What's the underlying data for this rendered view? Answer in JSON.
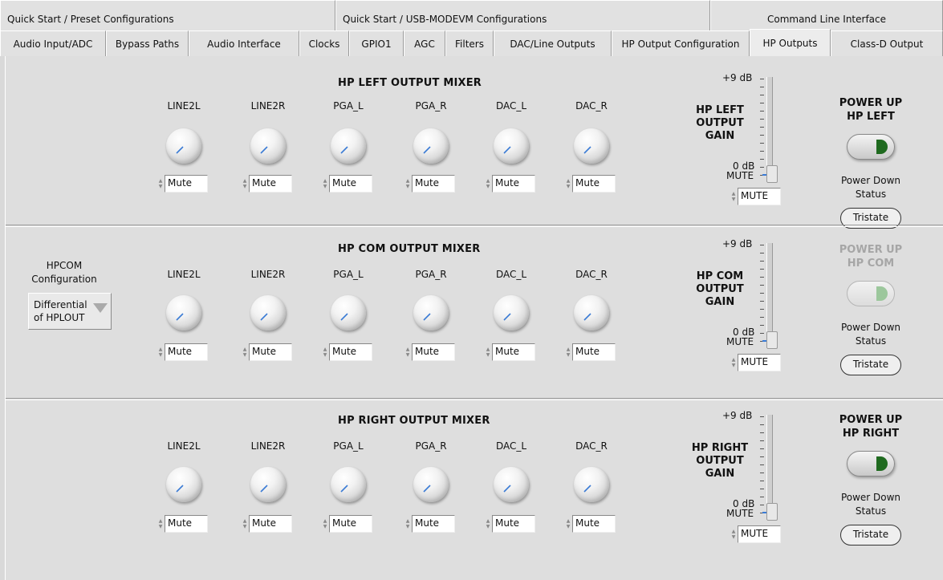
{
  "tabs_top": [
    "Quick Start / Preset Configurations",
    "Quick Start / USB-MODEVM Configurations",
    "Command Line Interface"
  ],
  "tabs_main": [
    "Audio Input/ADC",
    "Bypass Paths",
    "Audio Interface",
    "Clocks",
    "GPIO1",
    "AGC",
    "Filters",
    "DAC/Line Outputs",
    "HP Output Configuration",
    "HP Outputs",
    "Class-D Output"
  ],
  "active_tab": "HP Outputs",
  "channels": [
    "LINE2L",
    "LINE2R",
    "PGA_L",
    "PGA_R",
    "DAC_L",
    "DAC_R"
  ],
  "scale": {
    "top": "+9 dB",
    "zero": "0 dB",
    "mute": "MUTE"
  },
  "left": {
    "title": "HP LEFT OUTPUT MIXER",
    "values": [
      "Mute",
      "Mute",
      "Mute",
      "Mute",
      "Mute",
      "Mute"
    ],
    "gain_l1": "HP LEFT",
    "gain_l2": "OUTPUT",
    "gain_l3": "GAIN",
    "gain_value": "MUTE",
    "power_l1": "POWER UP",
    "power_l2": "HP LEFT",
    "status_l1": "Power Down",
    "status_l2": "Status",
    "status": "Tristate"
  },
  "com": {
    "title": "HP COM OUTPUT MIXER",
    "config_l1": "HPCOM",
    "config_l2": "Configuration",
    "config_v1": "Differential",
    "config_v2": "of HPLOUT",
    "values": [
      "Mute",
      "Mute",
      "Mute",
      "Mute",
      "Mute",
      "Mute"
    ],
    "gain_l1": "HP COM",
    "gain_l2": "OUTPUT",
    "gain_l3": "GAIN",
    "gain_value": "MUTE",
    "power_l1": "POWER UP",
    "power_l2": "HP COM",
    "status_l1": "Power Down",
    "status_l2": "Status",
    "status": "Tristate"
  },
  "right": {
    "title": "HP RIGHT OUTPUT MIXER",
    "values": [
      "Mute",
      "Mute",
      "Mute",
      "Mute",
      "Mute",
      "Mute"
    ],
    "gain_l1": "HP RIGHT",
    "gain_l2": "OUTPUT",
    "gain_l3": "GAIN",
    "gain_value": "MUTE",
    "power_l1": "POWER UP",
    "power_l2": "HP RIGHT",
    "status_l1": "Power Down",
    "status_l2": "Status",
    "status": "Tristate"
  },
  "colors": {
    "knob_indicator": "#3a7bd5",
    "led_on": "#1f6a1f",
    "led_disabled": "#9cc79c"
  },
  "icons": [
    "knob-indicator",
    "spin-arrows",
    "power-led",
    "dropdown-arrow"
  ]
}
